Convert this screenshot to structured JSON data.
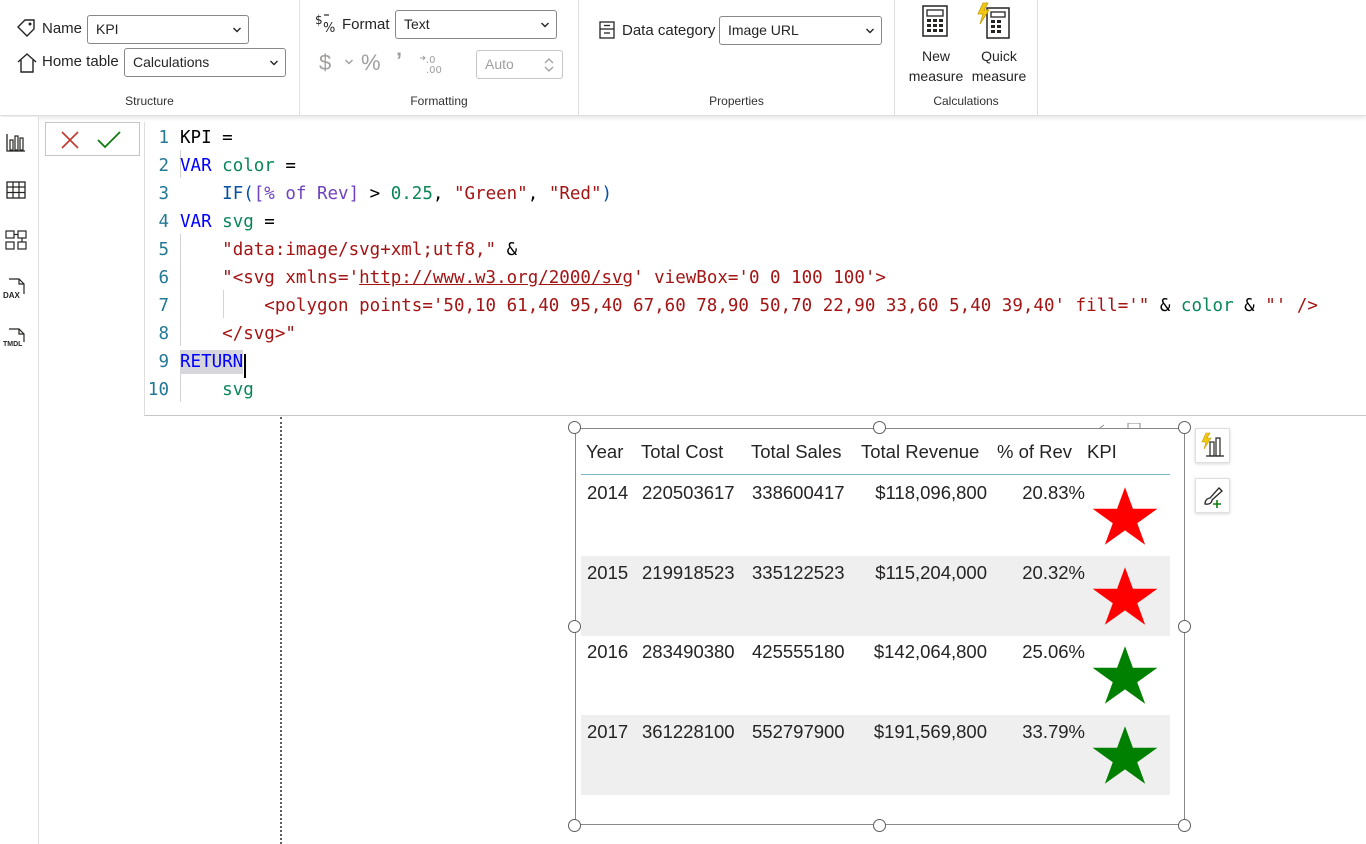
{
  "ribbon": {
    "structure": {
      "label": "Structure",
      "name_label": "Name",
      "name_value": "KPI",
      "home_table_label": "Home table",
      "home_table_value": "Calculations"
    },
    "formatting": {
      "label": "Formatting",
      "format_label": "Format",
      "format_value": "Text",
      "currency_symbol": "$",
      "percent_symbol": "%",
      "comma_symbol": "’",
      "decimals_placeholder": "Auto"
    },
    "properties": {
      "label": "Properties",
      "data_category_label": "Data category",
      "data_category_value": "Image URL"
    },
    "calculations": {
      "label": "Calculations",
      "new_measure_line1": "New",
      "new_measure_line2": "measure",
      "quick_measure_line1": "Quick",
      "quick_measure_line2": "measure"
    }
  },
  "rail": {
    "icons": [
      "report-view-icon",
      "table-view-icon",
      "model-view-icon",
      "dax-query-view-icon",
      "tmdl-view-icon"
    ],
    "dax_text": "DAX",
    "tmdl_text": "TMDL"
  },
  "editor": {
    "line_numbers": [
      "1",
      "2",
      "3",
      "4",
      "5",
      "6",
      "7",
      "8",
      "9",
      "10"
    ],
    "lines": [
      [
        {
          "t": "KPI =",
          "c": ""
        }
      ],
      [
        {
          "t": "VAR",
          "c": "kw"
        },
        {
          "t": " ",
          "c": ""
        },
        {
          "t": "color",
          "c": "var"
        },
        {
          "t": " =",
          "c": ""
        }
      ],
      [
        {
          "t": "    ",
          "c": ""
        },
        {
          "t": "IF(",
          "c": "fn"
        },
        {
          "t": "[% of Rev]",
          "c": "meas"
        },
        {
          "t": " > ",
          "c": ""
        },
        {
          "t": "0.25",
          "c": "num"
        },
        {
          "t": ", ",
          "c": ""
        },
        {
          "t": "\"Green\"",
          "c": "str"
        },
        {
          "t": ", ",
          "c": ""
        },
        {
          "t": "\"Red\"",
          "c": "str"
        },
        {
          "t": ")",
          "c": "fn"
        }
      ],
      [
        {
          "t": "VAR",
          "c": "kw"
        },
        {
          "t": " ",
          "c": ""
        },
        {
          "t": "svg",
          "c": "var"
        },
        {
          "t": " =",
          "c": ""
        }
      ],
      [
        {
          "t": "    ",
          "c": ""
        },
        {
          "t": "\"data:image/svg+xml;utf8,\"",
          "c": "str"
        },
        {
          "t": " &",
          "c": ""
        }
      ],
      [
        {
          "t": "    ",
          "c": ""
        },
        {
          "t": "\"<svg xmlns='",
          "c": "str"
        },
        {
          "t": "http://www.w3.org/2000/svg",
          "c": "url"
        },
        {
          "t": "' viewBox='0 0 100 100'>",
          "c": "str"
        }
      ],
      [
        {
          "t": "        ",
          "c": ""
        },
        {
          "t": "<polygon points='50,10 61,40 95,40 67,60 78,90 50,70 22,90 33,60 5,40 39,40' fill='\"",
          "c": "str"
        },
        {
          "t": " & ",
          "c": ""
        },
        {
          "t": "color",
          "c": "var"
        },
        {
          "t": " & ",
          "c": ""
        },
        {
          "t": "\"' />",
          "c": "str"
        }
      ],
      [
        {
          "t": "    ",
          "c": ""
        },
        {
          "t": "</svg>\"",
          "c": "str"
        }
      ],
      [
        {
          "t": "RETURN",
          "c": "kw"
        }
      ],
      [
        {
          "t": "    ",
          "c": ""
        },
        {
          "t": "svg",
          "c": "var"
        }
      ]
    ]
  },
  "table": {
    "headers": [
      "Year",
      "Total Cost",
      "Total Sales",
      "Total Revenue",
      "% of Rev",
      "KPI"
    ],
    "rows": [
      {
        "year": "2014",
        "cost": "220503617",
        "sales": "338600417",
        "revenue": "$118,096,800",
        "pct": "20.83%",
        "kpi_color": "#ff0000"
      },
      {
        "year": "2015",
        "cost": "219918523",
        "sales": "335122523",
        "revenue": "$115,204,000",
        "pct": "20.32%",
        "kpi_color": "#ff0000"
      },
      {
        "year": "2016",
        "cost": "283490380",
        "sales": "425555180",
        "revenue": "$142,064,800",
        "pct": "25.06%",
        "kpi_color": "#008000"
      },
      {
        "year": "2017",
        "cost": "361228100",
        "sales": "552797900",
        "revenue": "$191,569,800",
        "pct": "33.79%",
        "kpi_color": "#008000"
      }
    ]
  },
  "colors": {
    "accent": "#f2c811",
    "cancel": "#c0392b",
    "commit": "#107c10",
    "kpi_red": "#ff0000",
    "kpi_green": "#008000"
  }
}
